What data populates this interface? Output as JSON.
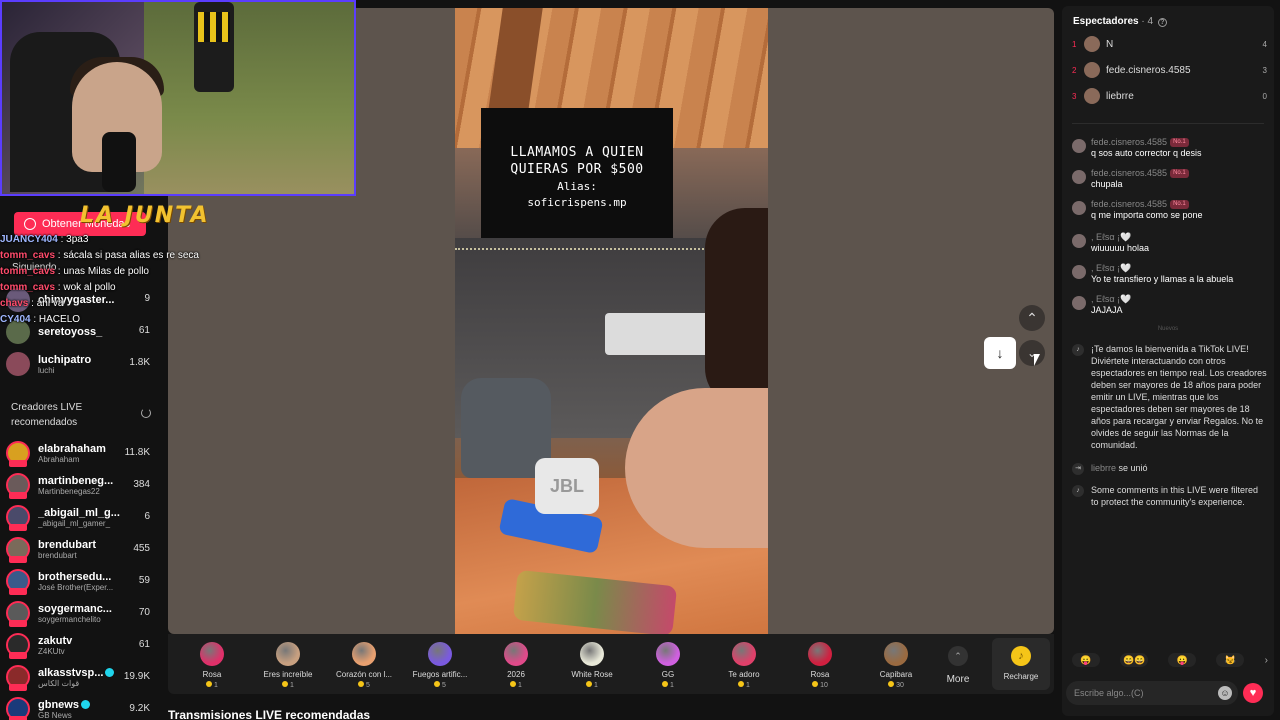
{
  "overlay": {
    "logo_text": "LA JUNTA",
    "obtener": "Obtener Monedas",
    "siguiendo": "Siguiendo",
    "chat": [
      {
        "user": "JUANCY404",
        "msg": " : 3pa3",
        "red": false
      },
      {
        "user": "tomm_cavs",
        "msg": " : sácala si pasa alias es re seca",
        "red": true
      },
      {
        "user": "tomm_cavs",
        "msg": " : unas Milas de pollo",
        "red": true
      },
      {
        "user": "tomm_cavs",
        "msg": " : wok al pollo",
        "red": true
      },
      {
        "user": "chavs",
        "msg": " : ahi va",
        "red": true
      },
      {
        "user": "CY404",
        "msg": " : HACELO",
        "red": false
      }
    ]
  },
  "sidebar": {
    "following": [
      {
        "name": "chinyygaster...",
        "sub": "",
        "count": "9",
        "color": "#6a5a7a"
      },
      {
        "name": "seretoyoss_",
        "sub": "",
        "count": "61",
        "color": "#5a6a4a"
      },
      {
        "name": "luchipatro",
        "sub": "luchi",
        "count": "1.8K",
        "color": "#8a4a5a"
      }
    ],
    "rec_title": "Creadores LIVE recomendados",
    "recommended": [
      {
        "name": "elabrahaham",
        "sub": "Abrahaham",
        "count": "11.8K",
        "color": "#d8a020",
        "verified": false
      },
      {
        "name": "martinbeneg...",
        "sub": "Martinbenegas22",
        "count": "384",
        "color": "#6a5a5a",
        "verified": false
      },
      {
        "name": "_abigail_ml_g...",
        "sub": "_abigail_ml_gamer_",
        "count": "6",
        "color": "#4a4a6a",
        "verified": false
      },
      {
        "name": "brendubart",
        "sub": "brendubart",
        "count": "455",
        "color": "#7a6a5a",
        "verified": false
      },
      {
        "name": "brothersedu...",
        "sub": "José Brother(Exper...",
        "count": "59",
        "color": "#3a5a8a",
        "verified": false
      },
      {
        "name": "soygermanc...",
        "sub": "soygermanchelito",
        "count": "70",
        "color": "#5a5a5a",
        "verified": false
      },
      {
        "name": "zakutv",
        "sub": "Z4KUtv",
        "count": "61",
        "color": "#2a2a2a",
        "verified": false
      },
      {
        "name": "alkasstvsp...",
        "sub": "قوات الكاس",
        "count": "19.9K",
        "color": "#8a2a2a",
        "verified": true
      },
      {
        "name": "gbnews",
        "sub": "GB News",
        "count": "9.2K",
        "color": "#1a3a7a",
        "verified": true
      }
    ]
  },
  "video": {
    "notice_line1": "LLAMAMOS A QUIEN",
    "notice_line2": "QUIERAS POR $500",
    "notice_line3": "Alias:",
    "notice_line4": "soficrispens.mp",
    "speaker_brand": "JBL"
  },
  "controls": {
    "up": "⌃",
    "down": "⌄",
    "download": "↓"
  },
  "gifts": [
    {
      "name": "Rosa",
      "price": "1",
      "color": "#e0306a"
    },
    {
      "name": "Eres increíble",
      "price": "1",
      "color": "#c8a080"
    },
    {
      "name": "Corazón con l...",
      "price": "5",
      "color": "#e8a070"
    },
    {
      "name": "Fuegos artific...",
      "price": "5",
      "color": "#7a5ae0"
    },
    {
      "name": "2026",
      "price": "1",
      "color": "#e04a8a"
    },
    {
      "name": "White Rose",
      "price": "1",
      "color": "#e8e8d8"
    },
    {
      "name": "GG",
      "price": "1",
      "color": "#d060e0"
    },
    {
      "name": "Te adoro",
      "price": "1",
      "color": "#e0406a"
    },
    {
      "name": "Rosa",
      "price": "10",
      "color": "#d02040"
    },
    {
      "name": "Capibara",
      "price": "30",
      "color": "#9a6a40"
    }
  ],
  "gift_more": "More",
  "recharge": "Recharge",
  "bottom_heading": "Transmisiones LIVE recomendadas",
  "right": {
    "title": "Espectadores",
    "count": " · 4",
    "viewers": [
      {
        "rank": "1",
        "name": "N",
        "score": "4"
      },
      {
        "rank": "2",
        "name": "fede.cisneros.4585",
        "score": "3"
      },
      {
        "rank": "3",
        "name": "liebrre",
        "score": "0"
      }
    ],
    "messages": [
      {
        "user": "fede.cisneros.4585",
        "badge": "No.1",
        "text": "q sos auto corrector q desis"
      },
      {
        "user": "fede.cisneros.4585",
        "badge": "No.1",
        "text": "chupala"
      },
      {
        "user": "fede.cisneros.4585",
        "badge": "No.1",
        "text": "q me importa como se pone"
      },
      {
        "user": ", Eℓѕα ¡🤍",
        "badge": "",
        "text": "wiuuuuu holaa"
      },
      {
        "user": ", Eℓѕα ¡🤍",
        "badge": "",
        "text": "Yo te transfiero y llamas a la abuela"
      },
      {
        "user": ", Eℓѕα ¡🤍",
        "badge": "",
        "text": "JAJAJA"
      }
    ],
    "new_label": "Nuevos",
    "welcome": "¡Te damos la bienvenida a TikTok LIVE! Diviértete interactuando con otros espectadores en tiempo real. Los creadores deben ser mayores de 18 años para poder emitir un LIVE, mientras que los espectadores deben ser mayores de 18 años para recargar y enviar Regalos. No te olvides de seguir las Normas de la comunidad.",
    "joined_user": "liebrre",
    "joined_text": " se unió",
    "filtered": "Some comments in this LIVE were filtered to protect the community's experience.",
    "input_placeholder": "Escribe algo...(C)"
  }
}
